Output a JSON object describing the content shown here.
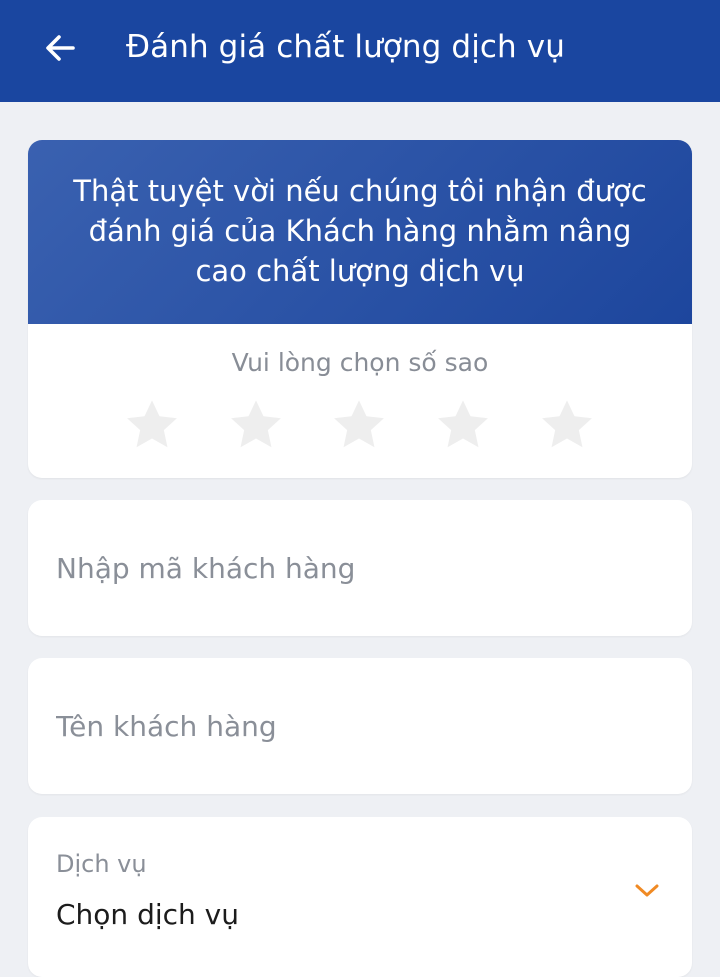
{
  "header": {
    "title": "Đánh giá chất lượng dịch vụ",
    "back_icon": "arrow-left-icon"
  },
  "rating": {
    "banner_text": "Thật tuyệt vời nếu chúng tôi nhận được đánh giá của Khách hàng nhằm nâng cao chất lượng dịch vụ",
    "prompt": "Vui lòng chọn số sao",
    "max_stars": 5,
    "selected_stars": 0,
    "star_icon": "star-icon",
    "star_color_empty": "#eeeeee"
  },
  "form": {
    "customer_code": {
      "placeholder": "Nhập mã khách hàng",
      "value": ""
    },
    "customer_name": {
      "placeholder": "Tên khách hàng",
      "value": ""
    },
    "service": {
      "label": "Dịch vụ",
      "value": "Chọn dịch vụ",
      "chevron_icon": "chevron-down-icon",
      "chevron_color": "#f08a24"
    }
  },
  "colors": {
    "app_bar": "#1a46a0",
    "banner": "#2a55a8",
    "background": "#eef0f4"
  }
}
